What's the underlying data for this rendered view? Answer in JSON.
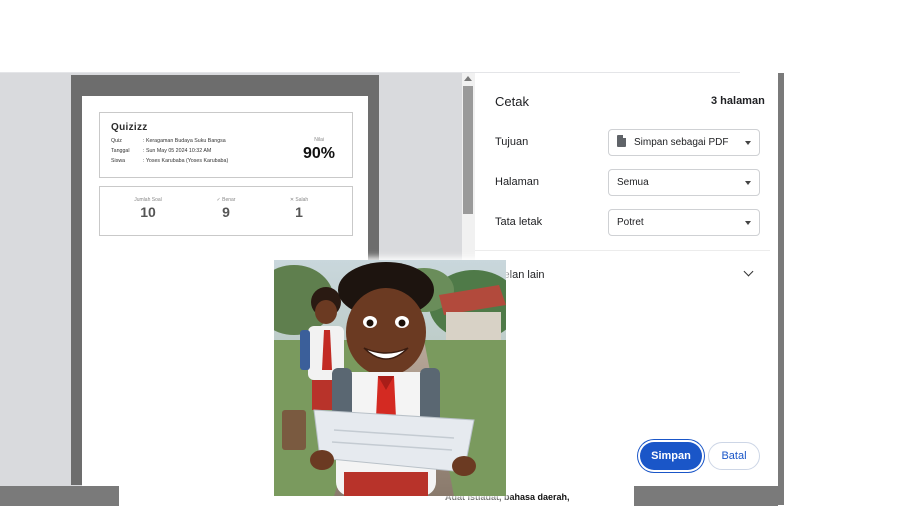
{
  "preview": {
    "logo": "Quizizz",
    "rows": [
      {
        "key": "Quiz",
        "value": ": Keragaman Budaya Suku Bangsa"
      },
      {
        "key": "Tanggal",
        "value": ": Sun May 05 2024 10:32 AM"
      },
      {
        "key": "Siswa",
        "value": ": Yoses Karubaba (Yoses Karubaba)"
      }
    ],
    "score_label": "Nilai",
    "score_value": "90%",
    "stats": [
      {
        "label": "Jumlah Soal",
        "value": "10"
      },
      {
        "label": "✓ Benar",
        "value": "9"
      },
      {
        "label": "✕ Salah",
        "value": "1"
      }
    ]
  },
  "print_panel": {
    "title": "Cetak",
    "page_count": "3 halaman",
    "destination_label": "Tujuan",
    "destination_value": "Simpan sebagai PDF",
    "pages_label": "Halaman",
    "pages_value": "Semua",
    "layout_label": "Tata letak",
    "layout_value": "Potret",
    "more_settings": "stelan lain",
    "save_button": "Simpan",
    "cancel_button": "Batal"
  },
  "caption": "Adat istiadat, bahasa daerah,",
  "colors": {
    "accent": "#1a56c8",
    "preview_bg": "#d9dadd",
    "page_border": "#6d6d6d"
  },
  "icons": {
    "destination": "pdf-file-icon",
    "dropdown": "caret-down-icon",
    "expand": "chevron-down-icon"
  }
}
